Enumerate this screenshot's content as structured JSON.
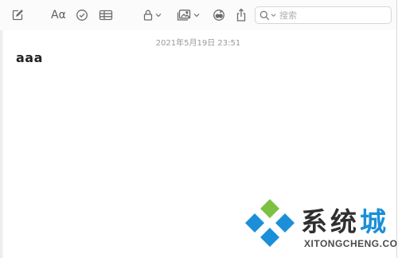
{
  "toolbar": {
    "icons": [
      "compose-icon",
      "format-text-icon",
      "checklist-icon",
      "table-icon",
      "lock-icon",
      "media-icon",
      "collaborate-icon",
      "share-icon"
    ],
    "format_label": "Aα",
    "search": {
      "placeholder": "搜索"
    }
  },
  "note": {
    "timestamp": "2021年5月19日 23:51",
    "body": "aaa"
  },
  "watermark": {
    "title_main": "系统",
    "title_last": "城",
    "subtitle": "XITONGCHENG.COM",
    "colors": {
      "blue": "#1b8fd8",
      "green": "#7dc142",
      "dark": "#2f2f2f"
    }
  }
}
